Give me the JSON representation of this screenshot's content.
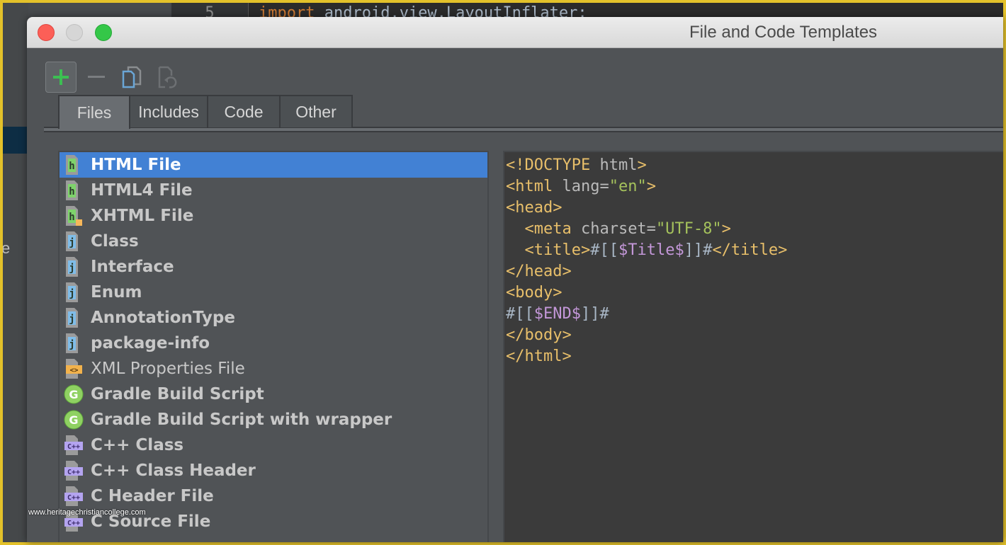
{
  "background_ide": {
    "line_number": "5",
    "code_keyword": "import",
    "code_rest": " android.view.LayoutInflater;",
    "partial_letter": "e"
  },
  "dialog": {
    "title": "File and Code Templates",
    "toolbar": {
      "add_icon": "plus-icon",
      "remove_icon": "minus-icon",
      "copy_icon": "copy-icon",
      "reset_icon": "reset-icon"
    },
    "tabs": [
      {
        "label": "Files",
        "active": true
      },
      {
        "label": "Includes",
        "active": false
      },
      {
        "label": "Code",
        "active": false
      },
      {
        "label": "Other",
        "active": false
      }
    ],
    "templates": [
      {
        "label": "HTML File",
        "icon": "html-file-icon",
        "selected": true
      },
      {
        "label": "HTML4 File",
        "icon": "html-file-icon"
      },
      {
        "label": "XHTML File",
        "icon": "xhtml-file-icon"
      },
      {
        "label": "Class",
        "icon": "java-file-icon"
      },
      {
        "label": "Interface",
        "icon": "java-file-icon"
      },
      {
        "label": "Enum",
        "icon": "java-file-icon"
      },
      {
        "label": "AnnotationType",
        "icon": "java-file-icon"
      },
      {
        "label": "package-info",
        "icon": "java-file-icon"
      },
      {
        "label": "XML Properties File",
        "icon": "xml-file-icon"
      },
      {
        "label": "Gradle Build Script",
        "icon": "gradle-icon"
      },
      {
        "label": "Gradle Build Script with wrapper",
        "icon": "gradle-icon"
      },
      {
        "label": "C++ Class",
        "icon": "cpp-file-icon"
      },
      {
        "label": "C++ Class Header",
        "icon": "cpp-file-icon"
      },
      {
        "label": "C Header File",
        "icon": "cpp-file-icon"
      },
      {
        "label": "C Source File",
        "icon": "cpp-file-icon"
      }
    ],
    "editor_lines": [
      [
        {
          "t": "<!DOCTYPE",
          "c": "tag"
        },
        {
          "t": " html",
          "c": "attr"
        },
        {
          "t": ">",
          "c": "tag"
        }
      ],
      [
        {
          "t": "<html",
          "c": "tag"
        },
        {
          "t": " lang=",
          "c": "attr"
        },
        {
          "t": "\"en\"",
          "c": "str"
        },
        {
          "t": ">",
          "c": "tag"
        }
      ],
      [
        {
          "t": "<head>",
          "c": "tag"
        }
      ],
      [
        {
          "t": "  <meta",
          "c": "tag"
        },
        {
          "t": " charset=",
          "c": "attr"
        },
        {
          "t": "\"UTF-8\"",
          "c": "str"
        },
        {
          "t": ">",
          "c": "tag"
        }
      ],
      [
        {
          "t": "  <title>",
          "c": "tag"
        },
        {
          "t": "#[[",
          "c": "esc"
        },
        {
          "t": "$Title$",
          "c": "var"
        },
        {
          "t": "]]#",
          "c": "esc"
        },
        {
          "t": "</title>",
          "c": "tag"
        }
      ],
      [
        {
          "t": "</head>",
          "c": "tag"
        }
      ],
      [
        {
          "t": "<body>",
          "c": "tag"
        }
      ],
      [
        {
          "t": "#[[",
          "c": "esc"
        },
        {
          "t": "$END$",
          "c": "var"
        },
        {
          "t": "]]#",
          "c": "esc"
        }
      ],
      [
        {
          "t": "</body>",
          "c": "tag"
        }
      ],
      [
        {
          "t": "</html>",
          "c": "tag"
        }
      ]
    ]
  },
  "watermark": "www.heritagechristiancollege.com",
  "colors": {
    "selection": "#4281d4",
    "frame": "#e3c12a",
    "tag": "#e8bf6a",
    "string": "#a5c25c",
    "variable": "#c397d8"
  }
}
